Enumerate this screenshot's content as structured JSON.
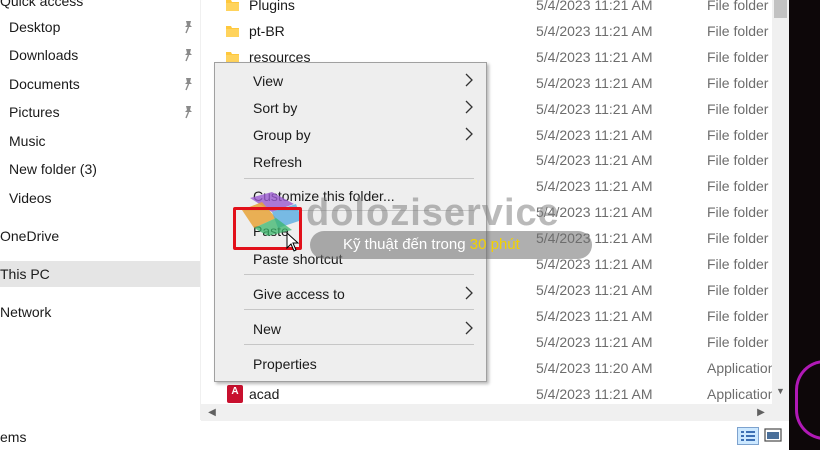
{
  "nav": {
    "items": [
      {
        "label": "Quick access",
        "top": true
      },
      {
        "label": "Desktop",
        "pinned": true
      },
      {
        "label": "Downloads",
        "pinned": true
      },
      {
        "label": "Documents",
        "pinned": true
      },
      {
        "label": "Pictures",
        "pinned": true
      },
      {
        "label": "Music"
      },
      {
        "label": "New folder (3)"
      },
      {
        "label": "Videos"
      },
      {
        "label": "OneDrive",
        "top": true
      },
      {
        "label": "This PC",
        "top": true,
        "selected": true
      },
      {
        "label": "Network",
        "top": true
      }
    ]
  },
  "files": [
    {
      "name": "Plugins",
      "date": "5/4/2023 11:21 AM",
      "type": "File folder",
      "icon": "folder-icon"
    },
    {
      "name": "pt-BR",
      "date": "5/4/2023 11:21 AM",
      "type": "File folder",
      "icon": "folder-icon"
    },
    {
      "name": "resources",
      "date": "5/4/2023 11:21 AM",
      "type": "File folder",
      "icon": "folder-icon"
    },
    {
      "name": "",
      "date": "5/4/2023 11:21 AM",
      "type": "File folder",
      "icon": ""
    },
    {
      "name": "",
      "date": "5/4/2023 11:21 AM",
      "type": "File folder",
      "icon": ""
    },
    {
      "name": "",
      "date": "5/4/2023 11:21 AM",
      "type": "File folder",
      "icon": ""
    },
    {
      "name": "",
      "date": "5/4/2023 11:21 AM",
      "type": "File folder",
      "icon": ""
    },
    {
      "name": "",
      "date": "5/4/2023 11:21 AM",
      "type": "File folder",
      "icon": ""
    },
    {
      "name": "",
      "date": "5/4/2023 11:21 AM",
      "type": "File folder",
      "icon": ""
    },
    {
      "name": "",
      "date": "5/4/2023 11:21 AM",
      "type": "File folder",
      "icon": ""
    },
    {
      "name": "",
      "date": "5/4/2023 11:21 AM",
      "type": "File folder",
      "icon": ""
    },
    {
      "name": "",
      "date": "5/4/2023 11:21 AM",
      "type": "File folder",
      "icon": ""
    },
    {
      "name": "",
      "date": "5/4/2023 11:21 AM",
      "type": "File folder",
      "icon": ""
    },
    {
      "name": "",
      "date": "5/4/2023 11:21 AM",
      "type": "File folder",
      "icon": ""
    },
    {
      "name": "",
      "date": "5/4/2023 11:20 AM",
      "type": "Application",
      "icon": ""
    },
    {
      "name": "acad",
      "date": "5/4/2023 11:21 AM",
      "type": "Application",
      "icon": "acad-icon"
    }
  ],
  "context_menu": {
    "items": [
      {
        "label": "View",
        "submenu": true
      },
      {
        "label": "Sort by",
        "submenu": true
      },
      {
        "label": "Group by",
        "submenu": true
      },
      {
        "label": "Refresh",
        "submenu": false
      },
      {
        "separator": true
      },
      {
        "label": "Customize this folder...",
        "submenu": false
      },
      {
        "separator": true
      },
      {
        "label": "Paste",
        "submenu": false,
        "highlighted": true
      },
      {
        "label": "Paste shortcut",
        "submenu": false
      },
      {
        "separator": true
      },
      {
        "label": "Give access to",
        "submenu": true
      },
      {
        "separator": true
      },
      {
        "label": "New",
        "submenu": true
      },
      {
        "separator": true
      },
      {
        "label": "Properties",
        "submenu": false
      }
    ]
  },
  "status": {
    "items_text": "ems"
  },
  "watermark": {
    "brand": "doloziservice",
    "tagline_main": "Kỹ thuật đến trong ",
    "tagline_highlight": "30 phút"
  },
  "colors": {
    "selection": "#e5e5e5",
    "menu_bg": "#eeeeee",
    "highlight_box": "#e2101a",
    "folder": "#ffc83d",
    "accent_glow": "#c21cc9"
  }
}
